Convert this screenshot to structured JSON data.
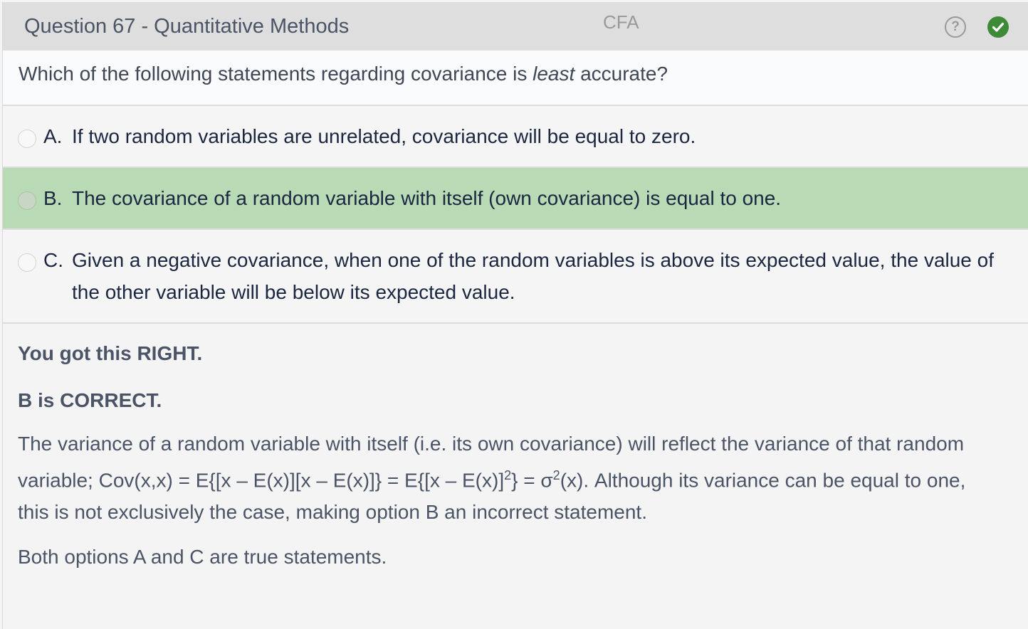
{
  "header": {
    "title": "Question 67 - Quantitative Methods",
    "brand": "CFA",
    "help_icon": "question-circle-icon",
    "status_icon": "check-circle-icon",
    "status_color": "#3d8b37"
  },
  "question": {
    "before": "Which of the following statements regarding covariance is ",
    "emph": "least",
    "after": " accurate?"
  },
  "options": [
    {
      "letter": "A.",
      "text": "If two random variables are unrelated, covariance will be equal to zero.",
      "selected": false
    },
    {
      "letter": "B.",
      "text": "The covariance of a random variable with itself (own covariance) is equal to one.",
      "selected": true
    },
    {
      "letter": "C.",
      "text": "Given a negative covariance, when one of the random variables is above its expected value, the value of the other variable will be below its expected value.",
      "selected": false
    }
  ],
  "selected_color": "#b8dab4",
  "explanation": {
    "result": "You got this RIGHT.",
    "correct": "B is CORRECT.",
    "p1a": "The variance of a random variable with itself (i.e. its own covariance) will reflect the variance of that random variable; Cov(x,x) = E{[x – E(x)][x – E(x)]} = E{[x – E(x)]",
    "sup1": "2",
    "p1b": "} = σ",
    "sup2": "2",
    "p1c": "(x).  Although its variance can be equal to one, this is not exclusively the case, making option B an incorrect statement.",
    "p2": "Both options A and C are true statements."
  }
}
